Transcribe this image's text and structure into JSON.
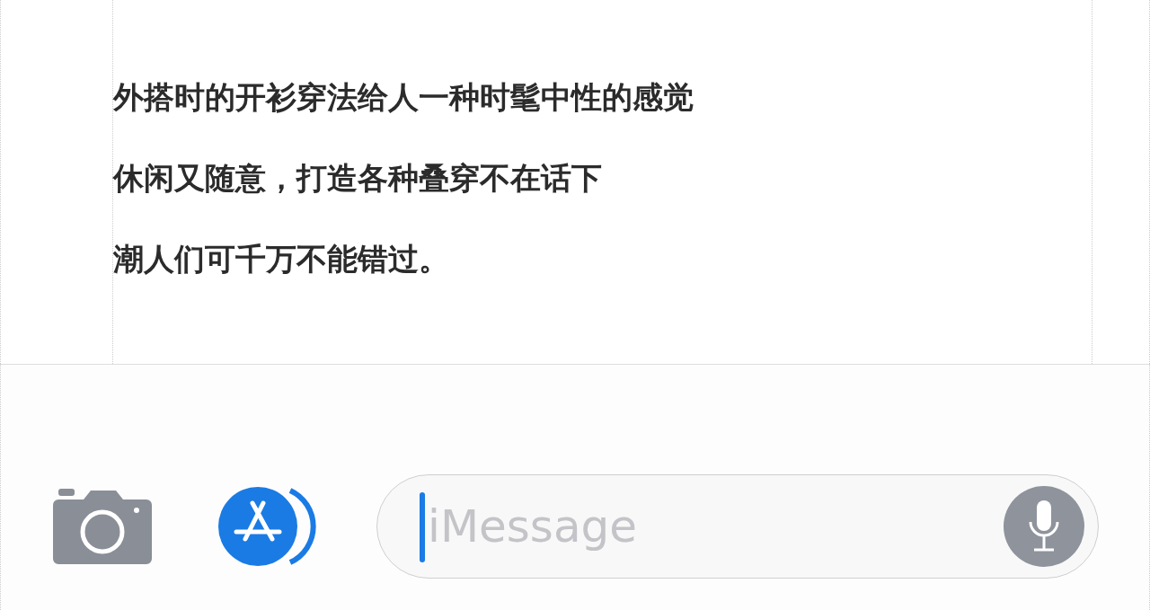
{
  "article": {
    "lines": [
      "外搭时的开衫穿法给人一种时髦中性的感觉",
      "休闲又随意，打造各种叠穿不在话下",
      "潮人们可千万不能错过。"
    ]
  },
  "composer": {
    "placeholder": "iMessage"
  }
}
